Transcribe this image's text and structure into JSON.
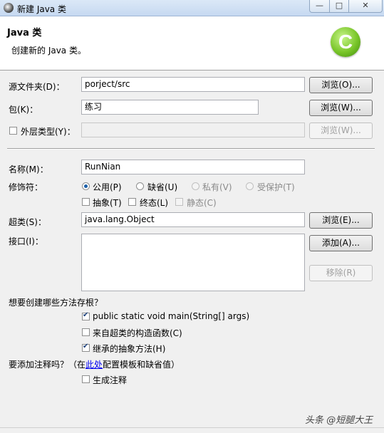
{
  "window": {
    "title": "新建 Java 类",
    "min_glyph": "—",
    "max_glyph": "□",
    "close_glyph": "✕"
  },
  "header": {
    "title": "Java 类",
    "subtitle": "创建新的 Java 类。",
    "logo_letter": "C"
  },
  "form": {
    "source_folder": {
      "label": "源文件夹(D)：",
      "value": "porject/src",
      "button": "浏览(O)..."
    },
    "package": {
      "label": "包(K)：",
      "value": "练习",
      "button": "浏览(W)..."
    },
    "enclosing_type": {
      "label": "外层类型(Y)：",
      "value": "",
      "button": "浏览(W)...",
      "checked": false
    },
    "name": {
      "label": "名称(M)：",
      "value": "RunNian"
    },
    "modifiers": {
      "label": "修饰符：",
      "radios": [
        {
          "label": "公用(P)",
          "checked": true,
          "enabled": true
        },
        {
          "label": "缺省(U)",
          "checked": false,
          "enabled": true
        },
        {
          "label": "私有(V)",
          "checked": false,
          "enabled": false
        },
        {
          "label": "受保护(T)",
          "checked": false,
          "enabled": false
        }
      ],
      "checks": [
        {
          "label": "抽象(T)",
          "checked": false,
          "enabled": true
        },
        {
          "label": "终态(L)",
          "checked": false,
          "enabled": true
        },
        {
          "label": "静态(C)",
          "checked": false,
          "enabled": false
        }
      ]
    },
    "superclass": {
      "label": "超类(S)：",
      "value": "java.lang.Object",
      "button": "浏览(E)..."
    },
    "interfaces": {
      "label": "接口(I)：",
      "add_button": "添加(A)...",
      "remove_button": "移除(R)"
    }
  },
  "stubs": {
    "question": "想要创建哪些方法存根？",
    "options": [
      {
        "label": "public static void main(String[] args)",
        "checked": true
      },
      {
        "label": "来自超类的构造函数(C)",
        "checked": false
      },
      {
        "label": "继承的抽象方法(H)",
        "checked": true
      }
    ]
  },
  "comments": {
    "question_prefix": "要添加注释吗？（在",
    "link": "此处",
    "question_suffix": "配置模板和缺省值）",
    "option": {
      "label": "生成注释",
      "checked": false
    }
  },
  "watermark": "头条 @短腿大王"
}
